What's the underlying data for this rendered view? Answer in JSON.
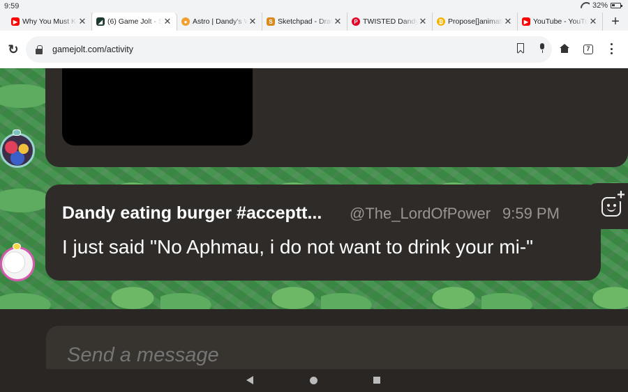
{
  "status_bar": {
    "time": "9:59",
    "battery": "32%"
  },
  "tabs": [
    {
      "label": "Why You Must Ke",
      "favicon": "youtube-icon",
      "color": "#ff0000",
      "active": false
    },
    {
      "label": "(6) Game Jolt - Sh",
      "favicon": "gamejolt-icon",
      "color": "#2f7f6f",
      "active": true
    },
    {
      "label": "Astro | Dandy's W",
      "favicon": "fandom-icon",
      "color": "#f0a030",
      "active": false
    },
    {
      "label": "Sketchpad - Draw",
      "favicon": "sketchpad-icon",
      "color": "#d98a1e",
      "active": false
    },
    {
      "label": "TWISTED Dandy's",
      "favicon": "pinterest-icon",
      "color": "#e60023",
      "active": false
    },
    {
      "label": "Propose[]animati",
      "favicon": "coin-icon",
      "color": "#f4b400",
      "active": false
    },
    {
      "label": "YouTube - YouTu",
      "favicon": "youtube-icon",
      "color": "#ff0000",
      "active": false
    }
  ],
  "address_bar": {
    "url": "gamejolt.com/activity",
    "tab_count": "7"
  },
  "message": {
    "author": "Dandy eating burger #acceptt...",
    "handle": "@The_LordOfPower",
    "time": "9:59 PM",
    "text": "I just said \"No Aphmau, i do not want to drink your mi-\""
  },
  "composer": {
    "placeholder": "Send a message"
  },
  "colors": {
    "background": "#2a2624",
    "card": "#2f2b29",
    "pattern_green": "#3c8e45",
    "text": "#ffffff",
    "muted": "#9a9492"
  }
}
